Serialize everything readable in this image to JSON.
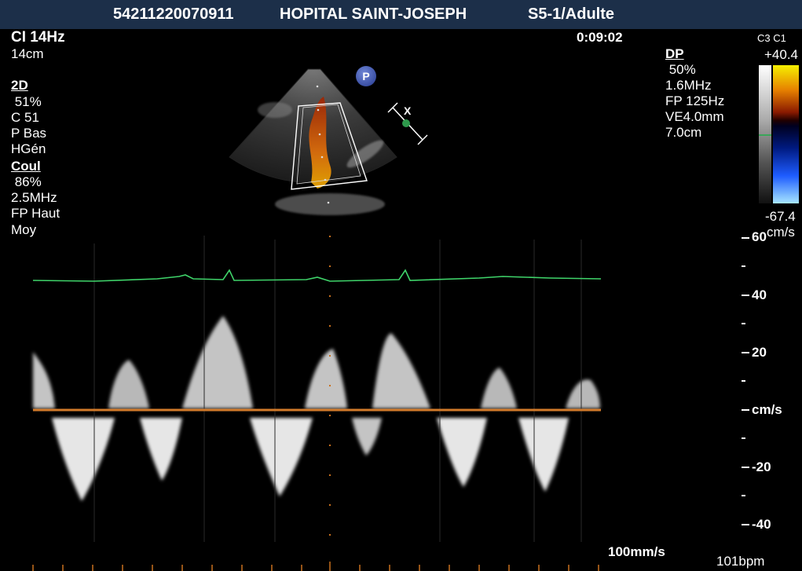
{
  "header": {
    "patient_id": "54211220070911",
    "hospital": "HOPITAL SAINT-JOSEPH",
    "probe_preset": "S5-1/Adulte"
  },
  "left_panel": {
    "frame_rate": "CI 14Hz",
    "depth": "14cm",
    "mode_2d": {
      "title": "2D",
      "gain": " 51%",
      "compression": "C 51",
      "power": "P Bas",
      "harmonic": "HGén"
    },
    "mode_color": {
      "title": "Coul",
      "gain": " 86%",
      "frequency": "2.5MHz",
      "filter": "FP Haut",
      "preset": "Moy"
    }
  },
  "timer": "0:09:02",
  "right_panel": {
    "title": "DP",
    "gain": " 50%",
    "frequency": "1.6MHz",
    "filter": "FP 125Hz",
    "sample_volume": "VE4.0mm",
    "gate_depth": "7.0cm"
  },
  "color_scale": {
    "header": "C3 C1",
    "max": "+40.4",
    "min": "-67.4",
    "unit": "cm/s"
  },
  "badge": "P",
  "gate_marker": "X",
  "doppler_scale": {
    "labels": [
      "60",
      "40",
      "20",
      "cm/s",
      "-20",
      "-40"
    ],
    "ticks": [
      60,
      50,
      40,
      30,
      20,
      10,
      0,
      -10,
      -20,
      -30,
      -40
    ]
  },
  "sweep_speed": "100mm/s",
  "heart_rate": "101bpm",
  "colors": {
    "header_bg": "#1c2f49",
    "ecg": "#3fd46a",
    "baseline": "#d27a2a",
    "cursor": "#c8701e"
  }
}
